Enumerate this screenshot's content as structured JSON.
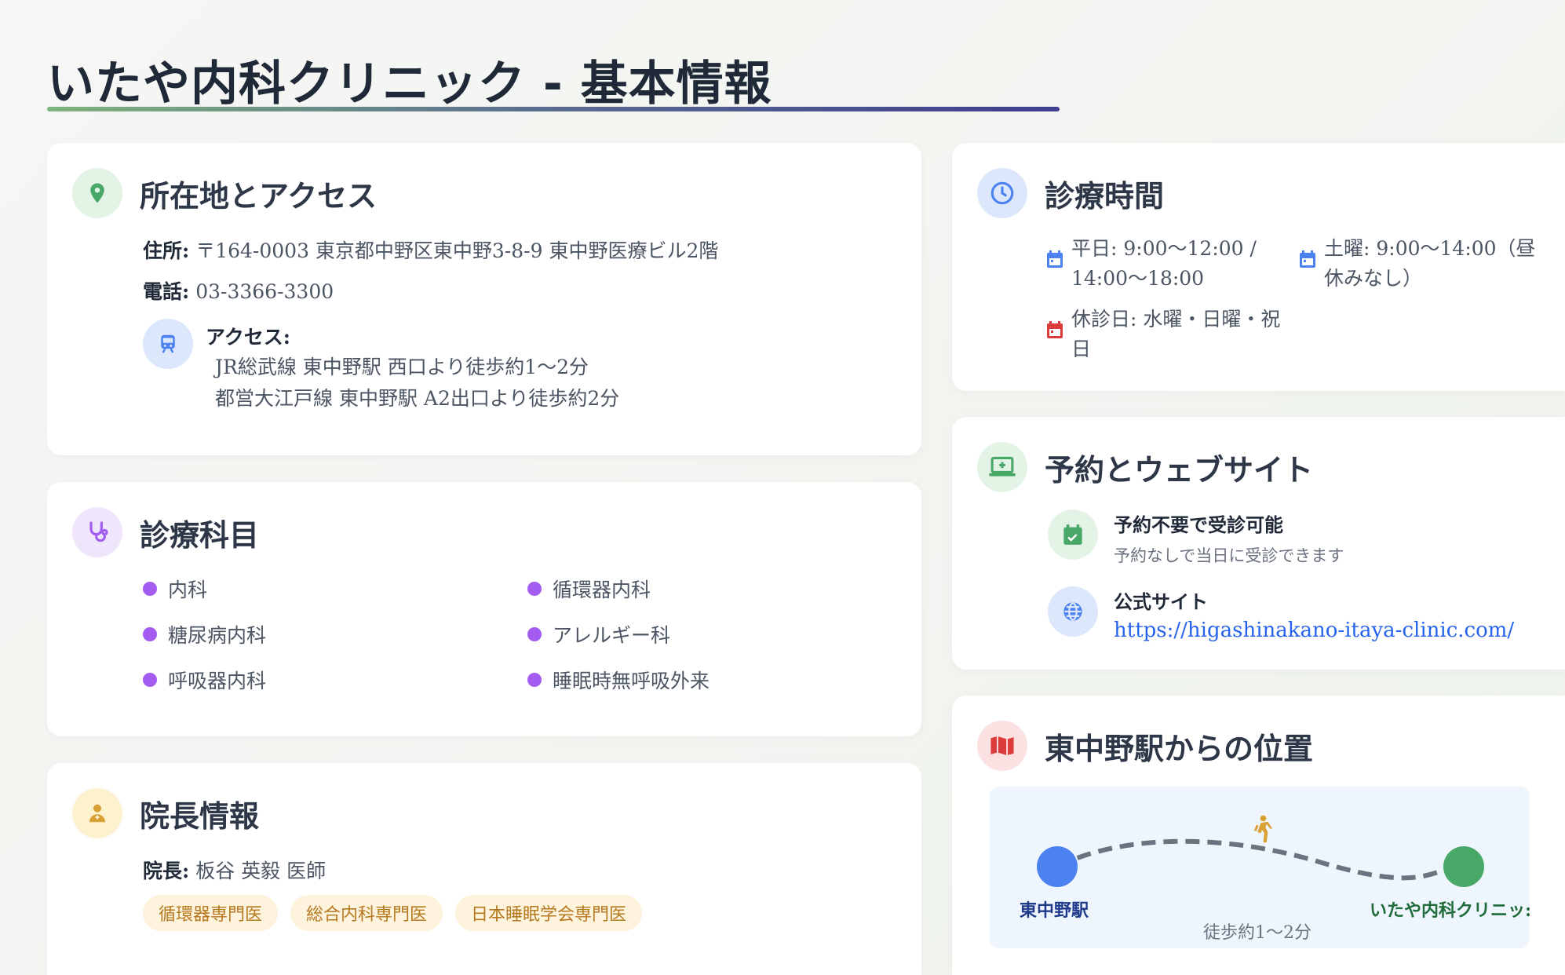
{
  "page": {
    "title": "いたや内科クリニック - 基本情報"
  },
  "location": {
    "title": "所在地とアクセス",
    "address_label": "住所:",
    "address_value": "〒164-0003 東京都中野区東中野3-8-9 東中野医療ビル2階",
    "phone_label": "電話:",
    "phone_value": "03-3366-3300",
    "access_label": "アクセス:",
    "access_lines": [
      "JR総武線 東中野駅 西口より徒歩約1〜2分",
      "都営大江戸線 東中野駅 A2出口より徒歩約2分"
    ]
  },
  "departments": {
    "title": "診療科目",
    "items": [
      "内科",
      "循環器内科",
      "糖尿病内科",
      "アレルギー科",
      "呼吸器内科",
      "睡眠時無呼吸外来"
    ]
  },
  "director": {
    "title": "院長情報",
    "name_label": "院長:",
    "name_value": "板谷 英毅 医師",
    "tags": [
      "循環器専門医",
      "総合内科専門医",
      "日本睡眠学会専門医"
    ]
  },
  "hours": {
    "title": "診療時間",
    "weekday_lines": [
      "平日: 9:00〜12:00 /",
      "14:00〜18:00"
    ],
    "saturday_lines": [
      "土曜: 9:00〜14:00（昼",
      "休みなし）"
    ],
    "closed_lines": [
      "休診日: 水曜・日曜・祝",
      "日"
    ]
  },
  "reservation": {
    "title": "予約とウェブサイト",
    "no_reservation_title": "予約不要で受診可能",
    "no_reservation_sub": "予約なしで当日に受診できます",
    "website_title": "公式サイト",
    "website_url": "https://higashinakano-itaya-clinic.com/"
  },
  "map": {
    "title": "東中野駅からの位置",
    "station_label": "東中野駅",
    "clinic_label": "いたや内科クリニッ:",
    "walk_label": "徒歩約1〜2分"
  },
  "colors": {
    "green": "#48a868",
    "blue": "#4b82f0",
    "purple": "#a25df0",
    "amber": "#d9a033",
    "red": "#dc3b3b"
  },
  "icons": {
    "location": "map-pin-icon",
    "access": "train-icon",
    "departments": "stethoscope-icon",
    "director": "doctor-icon",
    "hours": "clock-icon",
    "reservation": "laptop-medical-icon",
    "calendar": "calendar-icon",
    "globe": "globe-icon",
    "map": "map-icon",
    "walk": "walking-icon"
  }
}
